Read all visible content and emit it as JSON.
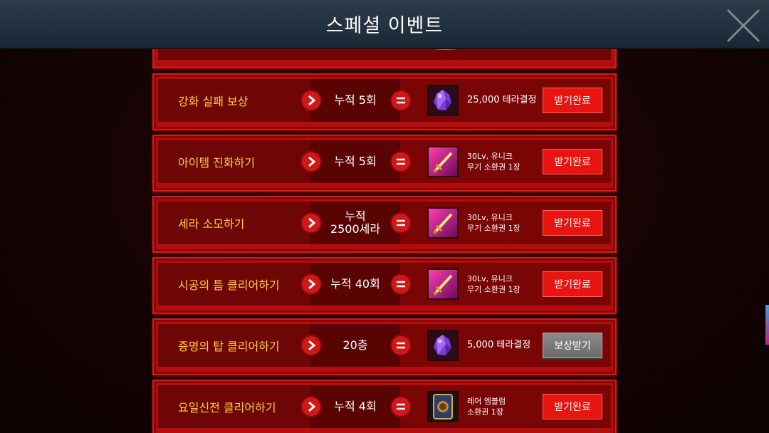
{
  "header": {
    "title": "스페셜 이벤트"
  },
  "events": [
    {
      "task": "강화 실패 보상",
      "condition": "누적 5회",
      "reward_icon": "purple-crystal-icon",
      "reward": "25,000 테라결정",
      "button": "받기완료",
      "status": "claimed"
    },
    {
      "task": "아이템 진화하기",
      "condition": "누적 5회",
      "reward_icon": "golden-sword-icon",
      "reward": "30Lv, 유니크\n무기 소환권 1장",
      "button": "받기완료",
      "status": "claimed"
    },
    {
      "task": "세라 소모하기",
      "condition": "누적\n2500세라",
      "reward_icon": "golden-sword-icon",
      "reward": "30Lv, 유니크\n무기 소환권 1장",
      "button": "받기완료",
      "status": "claimed"
    },
    {
      "task": "시공의 틈 클리어하기",
      "condition": "누적 40회",
      "reward_icon": "golden-sword-icon",
      "reward": "30Lv, 유니크\n무기 소환권 1장",
      "button": "받기완료",
      "status": "claimed"
    },
    {
      "task": "증명의 탑 클리어하기",
      "condition": "20층",
      "reward_icon": "purple-crystal-icon",
      "reward": "5,000 테라결정",
      "button": "보상받기",
      "status": "available"
    },
    {
      "task": "요일신전 클리어하기",
      "condition": "누적 4회",
      "reward_icon": "emblem-card-icon",
      "reward": "레어 엠블럼\n소환권 1장",
      "button": "받기완료",
      "status": "claimed"
    }
  ],
  "colors": {
    "header_bg": "#223040",
    "task_text": "#ffcf3a",
    "claim_button": "#e8140f",
    "available_button": "#7a7a7a",
    "row_border": "#d61a1a"
  }
}
